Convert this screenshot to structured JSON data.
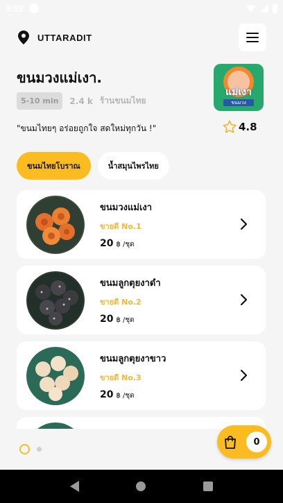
{
  "status_bar": {
    "time": "9:52"
  },
  "header": {
    "location": "UTTARADIT",
    "pin_icon": "location-pin-icon",
    "menu_icon": "hamburger-menu-icon"
  },
  "store": {
    "name": "ขนมวงแม่เงา.",
    "delivery_time": "5-10 min",
    "distance": "2.4 k",
    "category": "ร้านขนมไทย",
    "tagline": "\"ขนมไทยๆ อร่อยถูกใจ สดใหม่ทุกวัน !\"",
    "rating": "4.8",
    "logo": {
      "title": "แม่เงา",
      "subtitle": "ขนมวง"
    }
  },
  "tabs": [
    {
      "label": "ขนมไทยโบราณ",
      "active": true
    },
    {
      "label": "น้ำสมุนไพรไทย",
      "active": false
    }
  ],
  "products": [
    {
      "name": "ขนมวงแม่เงา",
      "rank": "ขายดี No.1",
      "price": "20",
      "unit": "฿ /ชุด"
    },
    {
      "name": "ขนมลูกตุยงาดำ",
      "rank": "ขายดี No.2",
      "price": "20",
      "unit": "฿ /ชุด"
    },
    {
      "name": "ขนมลูกตุยงาขาว",
      "rank": "ขายดี No.3",
      "price": "20",
      "unit": "฿ /ชุด"
    }
  ],
  "cart": {
    "count": "0",
    "icon": "shopping-bag-icon"
  },
  "colors": {
    "accent": "#fbbc22",
    "rank_text": "#f5b731",
    "background": "#f5f5f5"
  }
}
